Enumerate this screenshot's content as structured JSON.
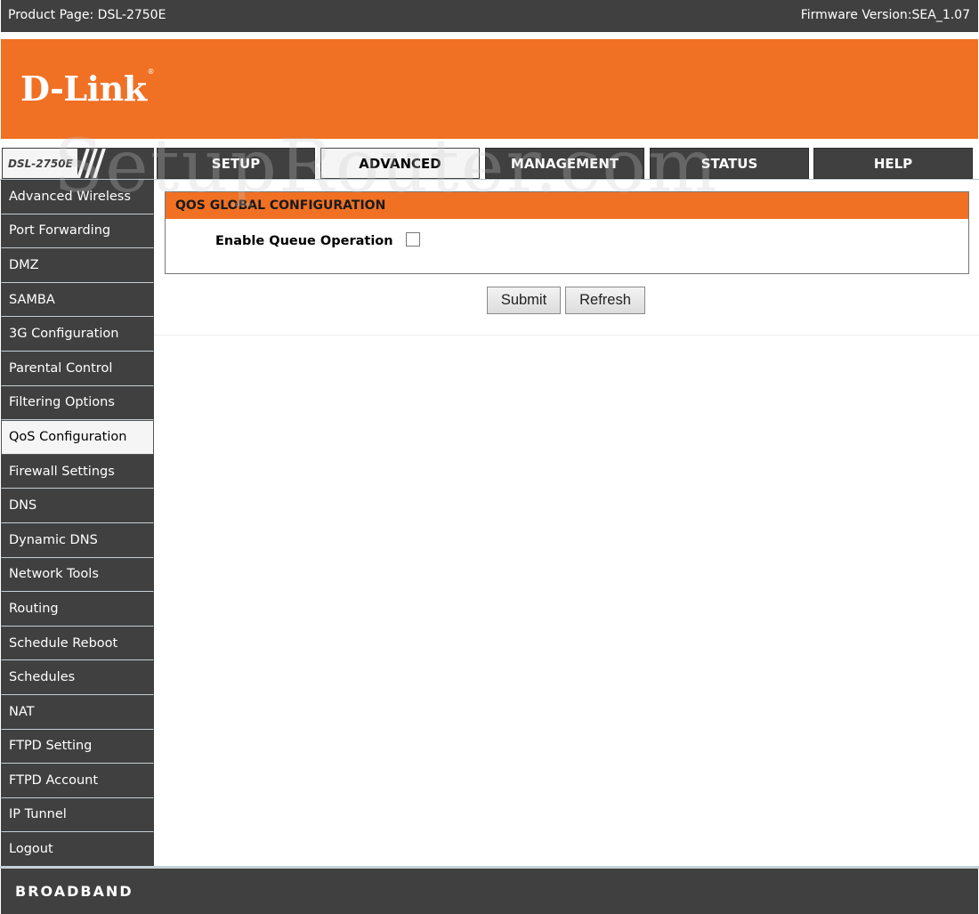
{
  "topbar": {
    "product_page": "Product Page: DSL-2750E",
    "firmware": "Firmware Version:SEA_1.07"
  },
  "banner": {
    "logo": "D-Link",
    "logo_mark": "®"
  },
  "model_label": "DSL-2750E",
  "tabs": [
    {
      "label": "SETUP",
      "active": false
    },
    {
      "label": "ADVANCED",
      "active": true
    },
    {
      "label": "MANAGEMENT",
      "active": false
    },
    {
      "label": "STATUS",
      "active": false
    },
    {
      "label": "HELP",
      "active": false
    }
  ],
  "sidebar": {
    "items": [
      {
        "label": "Advanced Wireless"
      },
      {
        "label": "Port Forwarding"
      },
      {
        "label": "DMZ"
      },
      {
        "label": "SAMBA"
      },
      {
        "label": "3G Configuration"
      },
      {
        "label": "Parental Control"
      },
      {
        "label": "Filtering Options"
      },
      {
        "label": "QoS Configuration",
        "active": true
      },
      {
        "label": "Firewall Settings"
      },
      {
        "label": "DNS"
      },
      {
        "label": "Dynamic DNS"
      },
      {
        "label": "Network Tools"
      },
      {
        "label": "Routing"
      },
      {
        "label": "Schedule Reboot"
      },
      {
        "label": "Schedules"
      },
      {
        "label": "NAT"
      },
      {
        "label": "FTPD Setting"
      },
      {
        "label": "FTPD Account"
      },
      {
        "label": "IP Tunnel"
      },
      {
        "label": "Logout"
      }
    ]
  },
  "main": {
    "panel_title": "QOS GLOBAL CONFIGURATION",
    "enable_queue_label": "Enable Queue Operation",
    "enable_queue_checked": false,
    "submit_label": "Submit",
    "refresh_label": "Refresh"
  },
  "footer": {
    "brand": "BROADBAND"
  },
  "watermark": "SetupRouter.com",
  "colors": {
    "accent": "#f07024",
    "dark": "#404040"
  }
}
